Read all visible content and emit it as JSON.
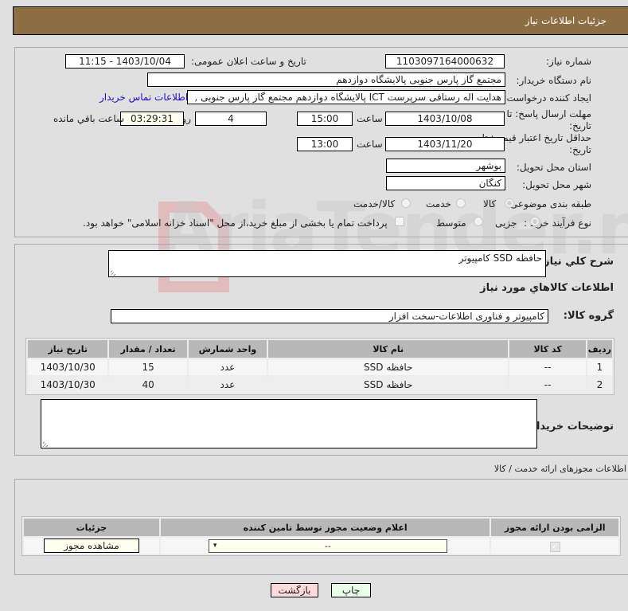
{
  "header": {
    "title": "جزئیات اطلاعات نیاز"
  },
  "details": {
    "need_number_label": "شماره نیاز:",
    "need_number": "1103097164000632",
    "announce_label": "تاریخ و ساعت اعلان عمومی:",
    "announce_value": "1403/10/04 - 11:15",
    "buyer_org_label": "نام دستگاه خریدار:",
    "buyer_org": "مجتمع گاز پارس جنوبی  پالایشگاه دوازدهم",
    "creator_label": "ایجاد کننده درخواست:",
    "creator": "هدایت اله رستاقی سرپرست ICT پالایشگاه دوازدهم  مجتمع گاز پارس جنوبی  ,",
    "buyer_contact_link": "اطلاعات تماس خریدار",
    "deadline_label": "مهلت ارسال پاسخ: تا تاریخ:",
    "deadline_date": "1403/10/08",
    "time_label": "ساعت",
    "deadline_time": "15:00",
    "days_value": "4",
    "days_label": "روز و",
    "remaining_time": "03:29:31",
    "remaining_label": "ساعت باقي مانده",
    "price_validity_label": "حداقل تاریخ اعتبار قیمت: تا تاریخ:",
    "price_validity_date": "1403/11/20",
    "price_validity_time": "13:00",
    "province_label": "استان محل تحویل:",
    "province": "بوشهر",
    "city_label": "شهر محل تحویل:",
    "city": "کنگان",
    "category_label": "طبقه بندی موضوعی:",
    "category_options": [
      "کالا",
      "خدمت",
      "کالا/خدمت"
    ],
    "category_selected": "کالا",
    "process_label": "نوع فرآیند خرید :",
    "process_options": [
      "جزیی",
      "متوسط"
    ],
    "process_selected": "جزیی",
    "treasury_note": "پرداخت تمام یا بخشی از مبلغ خرید،از محل \"اسناد خزانه اسلامی\" خواهد بود."
  },
  "summary": {
    "general_desc_label": "شرح کلي نیاز:",
    "general_desc": "حافظه SSD  کامپیوتر",
    "goods_info_title": "اطلاعات کالاهاي مورد نیاز",
    "goods_group_label": "گروه کالا:",
    "goods_group": "کامپیوتر و فناوری اطلاعات-سخت افزار"
  },
  "items_table": {
    "headers": [
      "ردیف",
      "کد کالا",
      "نام کالا",
      "واحد شمارش",
      "تعداد / مقدار",
      "تاریخ نیاز"
    ],
    "rows": [
      [
        "1",
        "--",
        "حافظه SSD",
        "عدد",
        "15",
        "1403/10/30"
      ],
      [
        "2",
        "--",
        "حافظه SSD",
        "عدد",
        "40",
        "1403/10/30"
      ]
    ]
  },
  "buyer_notes": {
    "label": "توضیحات خریدار:",
    "value": ""
  },
  "permits": {
    "title": "اطلاعات مجوزهای ارائه خدمت / کالا",
    "headers": [
      "الزامی بودن ارائه مجوز",
      "اعلام وضعیت مجوز توسط تامین کننده",
      "جزئیات"
    ],
    "row": {
      "required_checked": true,
      "status_select": "--",
      "details_button": "مشاهده مجوز"
    }
  },
  "footer": {
    "print_button": "چاپ",
    "back_button": "بازگشت"
  },
  "colors": {
    "header_bg": "#8d6e43",
    "print_bg": "#eaffea",
    "back_bg": "#ffdada",
    "link": "#1a0dcc"
  }
}
